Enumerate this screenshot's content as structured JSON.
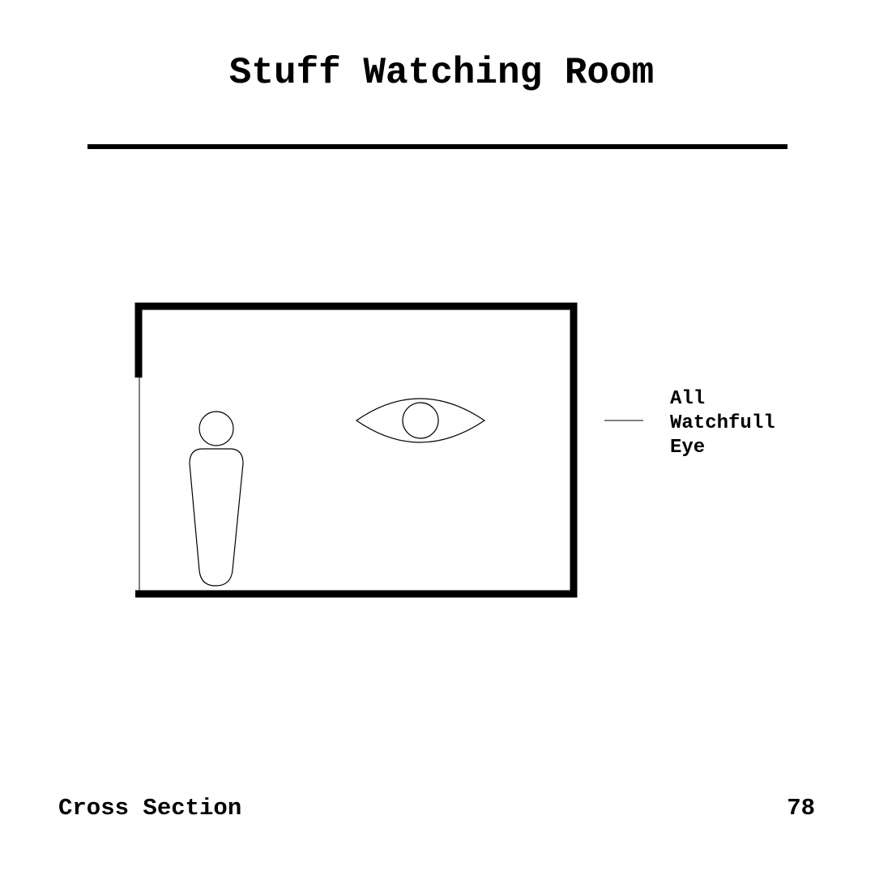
{
  "title": "Stuff Watching Room",
  "callout": {
    "lines": [
      "All",
      "Watchfull",
      "Eye"
    ]
  },
  "footer": {
    "view_label": "Cross Section",
    "page_number": "78"
  },
  "colors": {
    "ink": "#000000",
    "paper": "#ffffff"
  },
  "icons": {
    "figure": "person-figure-icon",
    "eye": "eye-icon"
  }
}
